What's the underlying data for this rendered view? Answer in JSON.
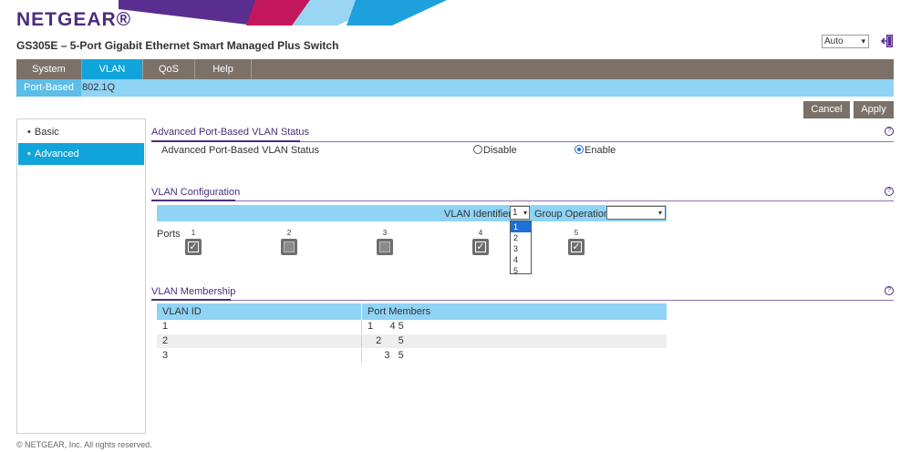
{
  "brand": {
    "logo": "NETGEAR®",
    "product_title": "GS305E – 5-Port Gigabit Ethernet Smart Managed Plus Switch"
  },
  "header": {
    "language_value": "Auto"
  },
  "tabs": [
    {
      "label": "System",
      "active": false
    },
    {
      "label": "VLAN",
      "active": true
    },
    {
      "label": "QoS",
      "active": false
    },
    {
      "label": "Help",
      "active": false
    }
  ],
  "subtabs": [
    {
      "label": "Port-Based",
      "active": true
    },
    {
      "label": "802.1Q",
      "active": false
    }
  ],
  "actions": {
    "cancel": "Cancel",
    "apply": "Apply"
  },
  "sidebar": {
    "items": [
      {
        "label": "Basic",
        "active": false
      },
      {
        "label": "Advanced",
        "active": true
      }
    ]
  },
  "status_section": {
    "title": "Advanced Port-Based VLAN Status",
    "label": "Advanced Port-Based VLAN Status",
    "options": [
      "Disable",
      "Enable"
    ],
    "selected": "Enable"
  },
  "config_section": {
    "title": "VLAN Configuration",
    "vlan_identifier_label": "VLAN Identifier",
    "vlan_identifier_value": "1",
    "vlan_identifier_options": [
      "1",
      "2",
      "3",
      "4",
      "5"
    ],
    "group_operation_label": "Group Operation",
    "group_operation_value": "",
    "ports_label": "Ports",
    "ports": [
      {
        "num": "1",
        "checked": true
      },
      {
        "num": "2",
        "checked": false
      },
      {
        "num": "3",
        "checked": false
      },
      {
        "num": "4",
        "checked": true
      },
      {
        "num": "5",
        "checked": true
      }
    ]
  },
  "membership_section": {
    "title": "VLAN Membership",
    "headers": [
      "VLAN ID",
      "Port Members"
    ],
    "rows": [
      {
        "vlan_id": "1",
        "members": "1      4 5"
      },
      {
        "vlan_id": "2",
        "members": "   2      5"
      },
      {
        "vlan_id": "3",
        "members": "      3   5"
      }
    ]
  },
  "footer": {
    "copyright": "© NETGEAR, Inc. All rights reserved."
  },
  "colors": {
    "brand_purple": "#4b2d7f",
    "tab_gray": "#7b7169",
    "active_blue": "#11a4db",
    "light_blue": "#8fd3f5"
  }
}
